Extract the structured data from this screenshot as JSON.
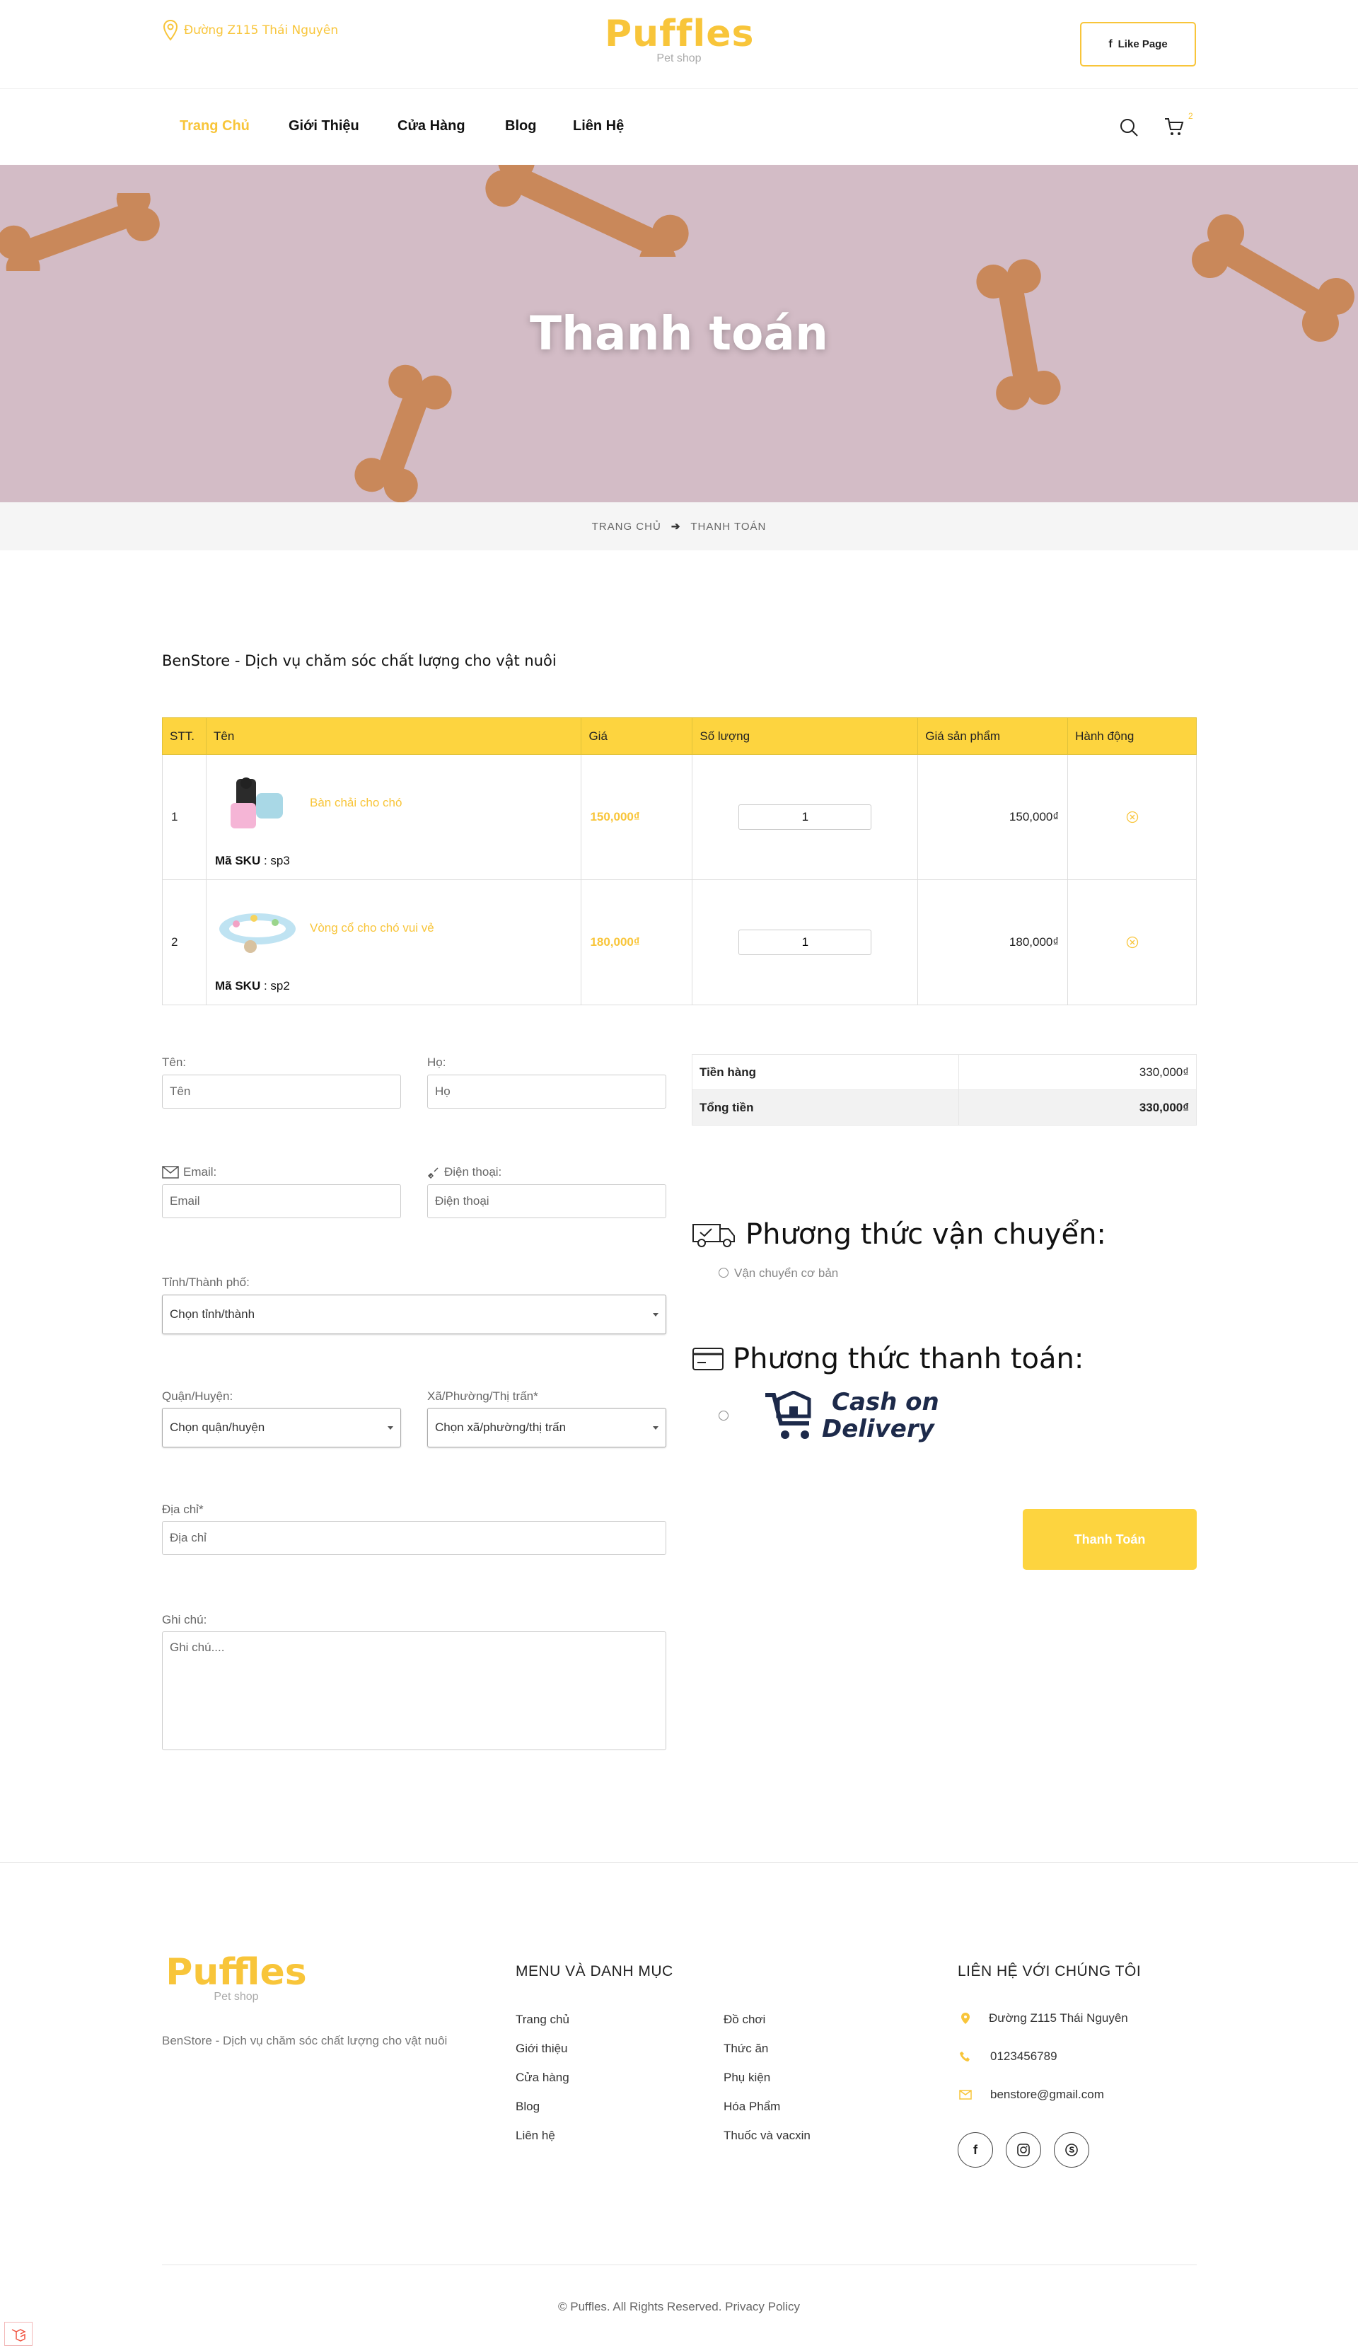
{
  "header": {
    "address": "Đường Z115 Thái Nguyên",
    "brand": "Puffles",
    "brand_sub": "Pet shop",
    "like_label": "Like Page"
  },
  "nav": {
    "items": [
      "Trang Chủ",
      "Giới Thiệu",
      "Cửa Hàng",
      "Blog",
      "Liên Hệ"
    ],
    "active_index": 0,
    "cart_count": "2"
  },
  "hero": {
    "title": "Thanh toán"
  },
  "breadcrumb": {
    "home": "TRANG CHỦ",
    "current": "THANH TOÁN"
  },
  "store_title": "BenStore - Dịch vụ chăm sóc chất lượng cho vật nuôi",
  "cart_table": {
    "headers": [
      "STT.",
      "Tên",
      "Giá",
      "Số lượng",
      "Giá sản phẩm",
      "Hành động"
    ],
    "sku_label": "Mã SKU",
    "rows": [
      {
        "index": "1",
        "name": "Bàn chải cho chó",
        "sku": "sp3",
        "price": "150,000₫",
        "qty": "1",
        "total": "150,000₫"
      },
      {
        "index": "2",
        "name": "Vòng cổ cho chó vui vẻ",
        "sku": "sp2",
        "price": "180,000₫",
        "qty": "1",
        "total": "180,000₫"
      }
    ]
  },
  "form": {
    "first_name_label": "Tên:",
    "first_name_ph": "Tên",
    "last_name_label": "Họ:",
    "last_name_ph": "Họ",
    "email_label": "Email:",
    "email_ph": "Email",
    "phone_label": "Điện thoại:",
    "phone_ph": "Điện thoại",
    "city_label": "Tỉnh/Thành phố:",
    "city_value": "Chọn tỉnh/thành",
    "district_label": "Quận/Huyện:",
    "district_value": "Chọn quận/huyện",
    "ward_label": "Xã/Phường/Thị trấn*",
    "ward_value": "Chọn xã/phường/thị trấn",
    "address_label": "Địa chỉ*",
    "address_ph": "Địa chỉ",
    "note_label": "Ghi chú:",
    "note_ph": "Ghi chú...."
  },
  "summary": {
    "subtotal_label": "Tiền hàng",
    "subtotal_value": "330,000₫",
    "total_label": "Tổng tiền",
    "total_value": "330,000₫"
  },
  "shipping": {
    "title": "Phương thức vận chuyển:",
    "option": "Vận chuyển cơ bản"
  },
  "payment": {
    "title": "Phương thức thanh toán:",
    "logo_line1": "Cash on",
    "logo_line2": "Delivery"
  },
  "pay_button": "Thanh Toán",
  "footer": {
    "brand": "Puffles",
    "brand_sub": "Pet shop",
    "desc": "BenStore - Dịch vụ chăm sóc chất lượng cho vật nuôi",
    "menu_title": "MENU VÀ DANH MỤC",
    "menu_col1": [
      "Trang chủ",
      "Giới thiệu",
      "Cửa hàng",
      "Blog",
      "Liên hệ"
    ],
    "menu_col2": [
      "Đồ chơi",
      "Thức ăn",
      "Phụ kiện",
      "Hóa Phẩm",
      "Thuốc và vacxin"
    ],
    "contact_title": "LIÊN HỆ VỚI CHÚNG TÔI",
    "contact_address": "Đường Z115 Thái Nguyên",
    "contact_phone": "0123456789",
    "contact_email": "benstore@gmail.com",
    "copyright": "©  Puffles. All Rights Reserved. Privacy Policy"
  },
  "colors": {
    "accent": "#fdd43f",
    "accent_text": "#f8c53a"
  }
}
